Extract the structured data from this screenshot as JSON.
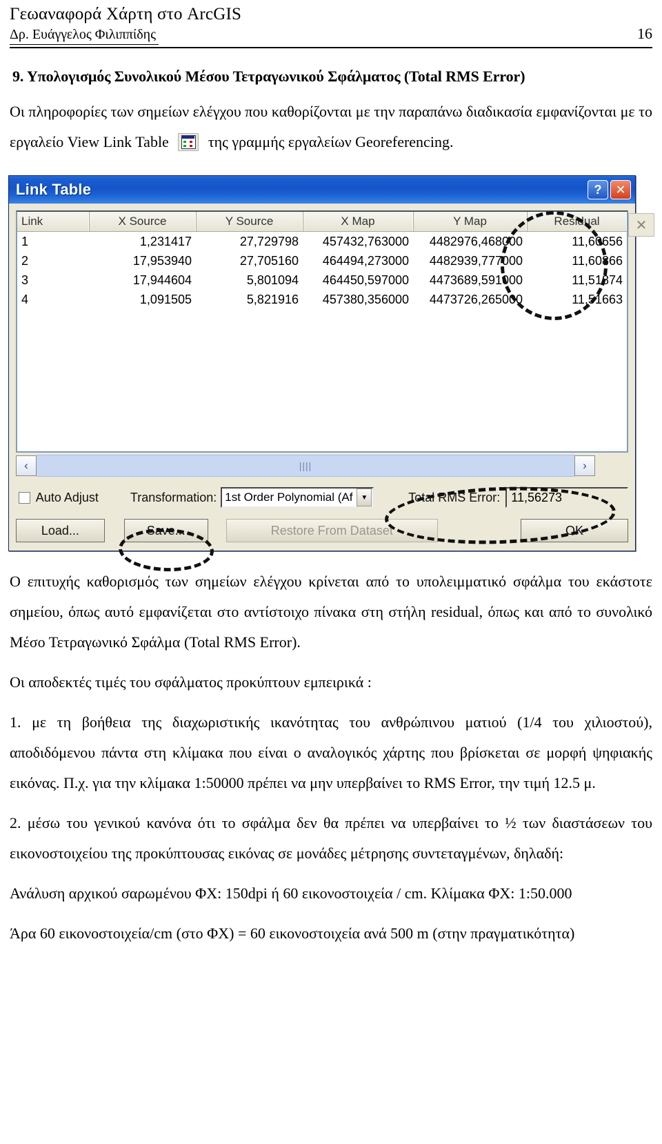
{
  "header": {
    "title": "Γεωαναφορά Χάρτη στο ArcGIS",
    "author": "Δρ. Ευάγγελος Φιλιππίδης",
    "page_number": "16"
  },
  "section": {
    "heading": "9. Υπολογισμός Συνολικού Μέσου Τετραγωνικού Σφάλματος (Total RMS Error)",
    "intro_part1": "Οι πληροφορίες των σημείων ελέγχου που καθορίζονται με την παραπάνω διαδικασία εμφανίζονται με το εργαλείο View Link Table",
    "intro_part2": "της γραμμής εργαλείων Georeferencing."
  },
  "dialog": {
    "title": "Link Table",
    "help_button": "?",
    "close_button": "✕",
    "columns": [
      "Link",
      "X Source",
      "Y Source",
      "X Map",
      "Y Map",
      "Residual"
    ],
    "rows": [
      [
        "1",
        "1,231417",
        "27,729798",
        "457432,763000",
        "4482976,468000",
        "11,60656"
      ],
      [
        "2",
        "17,953940",
        "27,705160",
        "464494,273000",
        "4482939,777000",
        "11,60866"
      ],
      [
        "3",
        "17,944604",
        "5,801094",
        "464450,597000",
        "4473689,591000",
        "11,51874"
      ],
      [
        "4",
        "1,091505",
        "5,821916",
        "457380,356000",
        "4473726,265000",
        "11,51663"
      ]
    ],
    "scroll_left": "‹",
    "scroll_right": "›",
    "scroll_grip": "||||",
    "auto_adjust_label": "Auto Adjust",
    "transformation_label": "Transformation:",
    "transformation_value": "1st Order Polynomial (Af",
    "dropdown_arrow": "▼",
    "total_rms_label": "Total RMS Error:",
    "total_rms_value": "11,56273",
    "buttons": {
      "load": "Load...",
      "save": "Save...",
      "restore": "Restore From Dataset",
      "ok": "OK"
    },
    "row_delete_icon": "✕"
  },
  "body": {
    "p1": "Ο επιτυχής καθορισμός των σημείων ελέγχου κρίνεται από το υπολειμματικό σφάλμα του εκάστοτε σημείου, όπως αυτό εμφανίζεται στο αντίστοιχο πίνακα στη στήλη residual, όπως και από το συνολικό Μέσο Τετραγωνικό Σφάλμα (Total RMS Error).",
    "p2": "Οι αποδεκτές τιμές του σφάλματος προκύπτουν εμπειρικά :",
    "p3": "1. με τη βοήθεια της διαχωριστικής ικανότητας του ανθρώπινου ματιού (1/4 του χιλιοστού), αποδιδόμενου πάντα στη κλίμακα που είναι ο αναλογικός χάρτης που βρίσκεται σε μορφή ψηφιακής εικόνας. Π.χ. για την κλίμακα 1:50000 πρέπει να μην υπερβαίνει το RMS Error, την τιμή 12.5 μ.",
    "p4": "2. μέσω του γενικού κανόνα ότι το σφάλμα δεν θα πρέπει να υπερβαίνει το ½ των διαστάσεων του εικονοστοιχείου της προκύπτουσας εικόνας σε μονάδες μέτρησης συντεταγμένων, δηλαδή:",
    "p5": "Ανάλυση αρχικού σαρωμένου ΦΧ: 150dpi ή 60 εικονοστοιχεία / cm. Κλίμακα ΦΧ: 1:50.000",
    "p6": "Άρα 60 εικονοστοιχεία/cm (στο ΦΧ) = 60 εικονοστοιχεία ανά 500 m (στην πραγματικότητα)"
  },
  "colors": {
    "titlebar_blue": "#1553c9",
    "dialog_face": "#ece9d8",
    "annotation": "#111111"
  }
}
